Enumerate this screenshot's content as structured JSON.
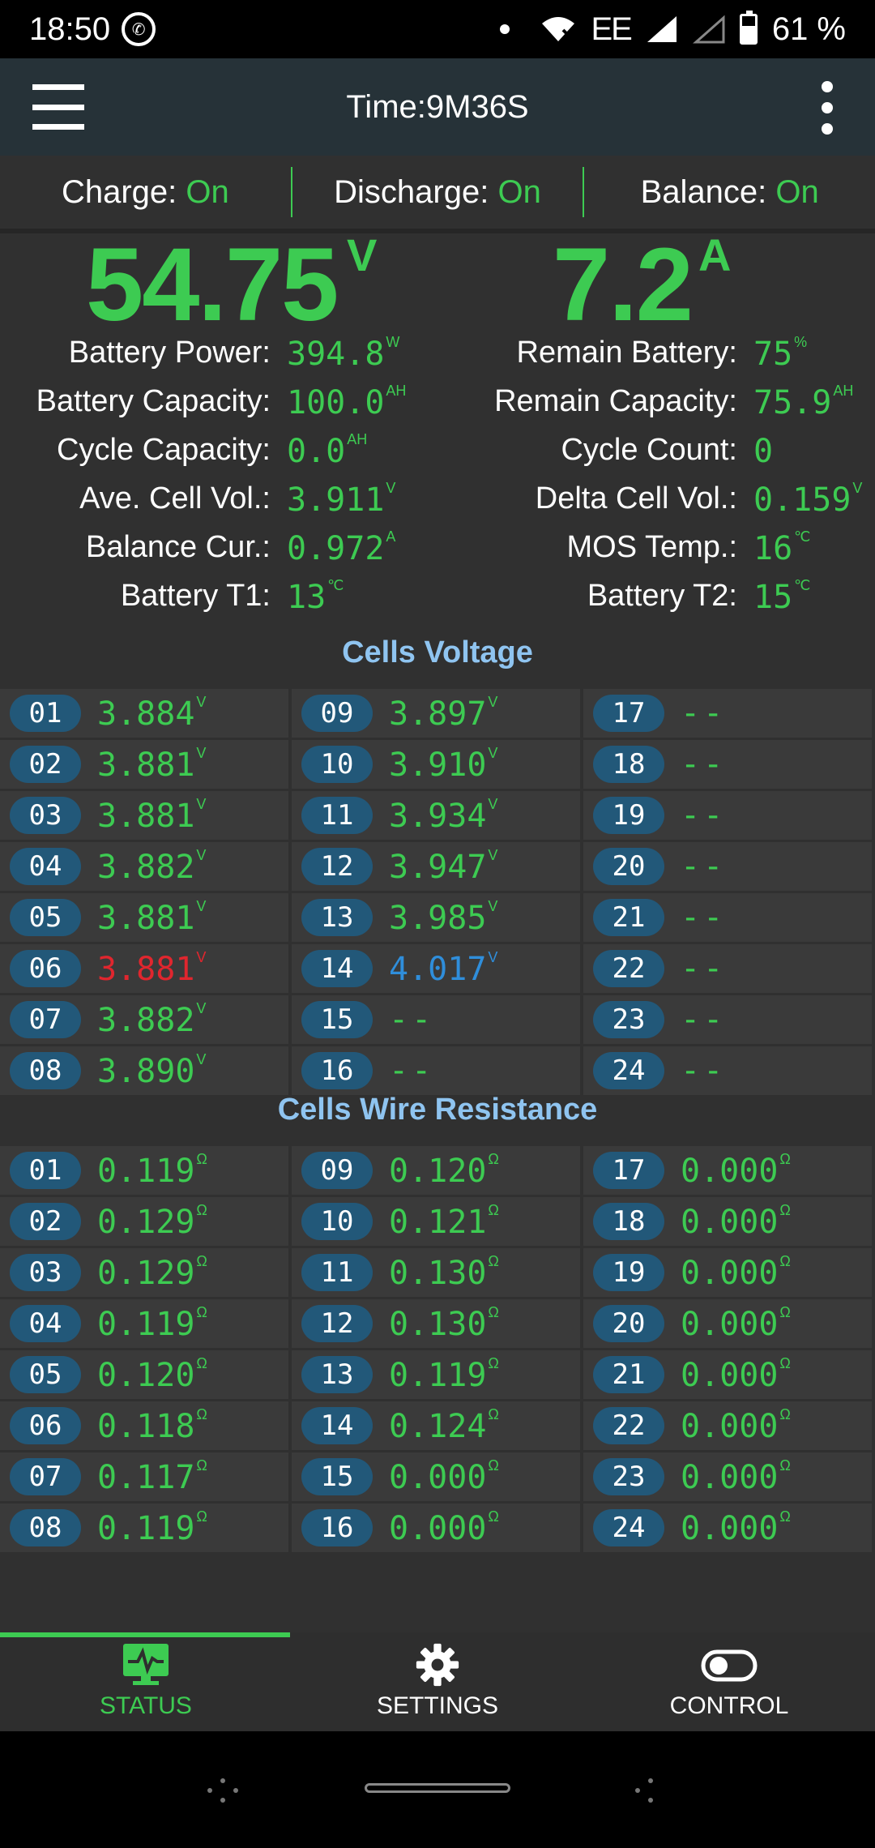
{
  "status_bar": {
    "time": "18:50",
    "e_label": "EE",
    "battery": "61 %",
    "battery_level_percent": 61
  },
  "app_bar": {
    "title": "Time:9M36S"
  },
  "switches": [
    {
      "label": "Charge:",
      "value": "On"
    },
    {
      "label": "Discharge:",
      "value": "On"
    },
    {
      "label": "Balance:",
      "value": "On"
    }
  ],
  "voltage": {
    "value": "54.75",
    "unit": "V"
  },
  "current": {
    "value": "7.2",
    "unit": "A"
  },
  "info_left": [
    {
      "label": "Battery Power:",
      "value": "394.8",
      "unit": "W"
    },
    {
      "label": "Battery Capacity:",
      "value": "100.0",
      "unit": "AH"
    },
    {
      "label": "Cycle Capacity:",
      "value": "0.0",
      "unit": "AH"
    },
    {
      "label": "Ave. Cell Vol.:",
      "value": "3.911",
      "unit": "V"
    },
    {
      "label": "Balance Cur.:",
      "value": "0.972",
      "unit": "A"
    },
    {
      "label": "Battery T1:",
      "value": "13",
      "unit": "℃"
    }
  ],
  "info_right": [
    {
      "label": "Remain Battery:",
      "value": "75",
      "unit": "%"
    },
    {
      "label": "Remain Capacity:",
      "value": "75.9",
      "unit": "AH"
    },
    {
      "label": "Cycle Count:",
      "value": "0",
      "unit": ""
    },
    {
      "label": "Delta Cell Vol.:",
      "value": "0.159",
      "unit": "V"
    },
    {
      "label": "MOS Temp.:",
      "value": "16",
      "unit": "℃"
    },
    {
      "label": "Battery T2:",
      "value": "15",
      "unit": "℃"
    }
  ],
  "cells_voltage": {
    "title": "Cells Voltage",
    "unit": "V",
    "cells": [
      {
        "id": "01",
        "value": "3.884"
      },
      {
        "id": "02",
        "value": "3.881"
      },
      {
        "id": "03",
        "value": "3.881"
      },
      {
        "id": "04",
        "value": "3.882"
      },
      {
        "id": "05",
        "value": "3.881"
      },
      {
        "id": "06",
        "value": "3.881",
        "state": "low"
      },
      {
        "id": "07",
        "value": "3.882"
      },
      {
        "id": "08",
        "value": "3.890"
      },
      {
        "id": "09",
        "value": "3.897"
      },
      {
        "id": "10",
        "value": "3.910"
      },
      {
        "id": "11",
        "value": "3.934"
      },
      {
        "id": "12",
        "value": "3.947"
      },
      {
        "id": "13",
        "value": "3.985"
      },
      {
        "id": "14",
        "value": "4.017",
        "state": "high"
      },
      {
        "id": "15",
        "value": "--"
      },
      {
        "id": "16",
        "value": "--"
      },
      {
        "id": "17",
        "value": "--"
      },
      {
        "id": "18",
        "value": "--"
      },
      {
        "id": "19",
        "value": "--"
      },
      {
        "id": "20",
        "value": "--"
      },
      {
        "id": "21",
        "value": "--"
      },
      {
        "id": "22",
        "value": "--"
      },
      {
        "id": "23",
        "value": "--"
      },
      {
        "id": "24",
        "value": "--"
      }
    ]
  },
  "cells_resistance": {
    "title": "Cells Wire Resistance",
    "unit": "Ω",
    "cells": [
      {
        "id": "01",
        "value": "0.119"
      },
      {
        "id": "02",
        "value": "0.129"
      },
      {
        "id": "03",
        "value": "0.129"
      },
      {
        "id": "04",
        "value": "0.119"
      },
      {
        "id": "05",
        "value": "0.120"
      },
      {
        "id": "06",
        "value": "0.118"
      },
      {
        "id": "07",
        "value": "0.117"
      },
      {
        "id": "08",
        "value": "0.119"
      },
      {
        "id": "09",
        "value": "0.120"
      },
      {
        "id": "10",
        "value": "0.121"
      },
      {
        "id": "11",
        "value": "0.130"
      },
      {
        "id": "12",
        "value": "0.130"
      },
      {
        "id": "13",
        "value": "0.119"
      },
      {
        "id": "14",
        "value": "0.124"
      },
      {
        "id": "15",
        "value": "0.000"
      },
      {
        "id": "16",
        "value": "0.000"
      },
      {
        "id": "17",
        "value": "0.000"
      },
      {
        "id": "18",
        "value": "0.000"
      },
      {
        "id": "19",
        "value": "0.000"
      },
      {
        "id": "20",
        "value": "0.000"
      },
      {
        "id": "21",
        "value": "0.000"
      },
      {
        "id": "22",
        "value": "0.000"
      },
      {
        "id": "23",
        "value": "0.000"
      },
      {
        "id": "24",
        "value": "0.000"
      }
    ]
  },
  "bottom_nav": [
    {
      "label": "STATUS",
      "icon": "monitor-pulse-icon",
      "active": true
    },
    {
      "label": "SETTINGS",
      "icon": "gear-icon",
      "active": false
    },
    {
      "label": "CONTROL",
      "icon": "toggle-icon",
      "active": false
    }
  ],
  "colors": {
    "accent": "#3dcb52",
    "low": "#e0262e",
    "high": "#2f8edb",
    "section": "#8fc4f0",
    "badge": "#225879",
    "app_bar": "#263238"
  }
}
